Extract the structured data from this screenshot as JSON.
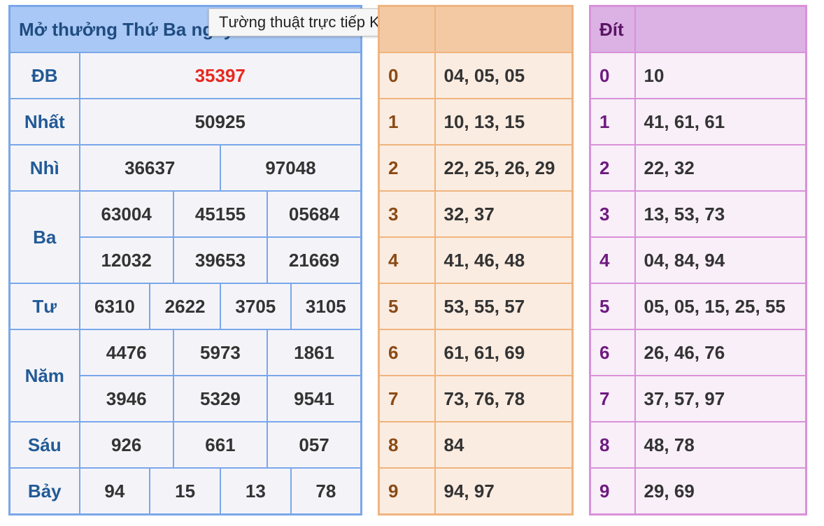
{
  "tooltip": "Tường thuật trực tiếp KQXS",
  "results": {
    "title": "Mở thưởng Thứ Ba ngày",
    "rows": [
      {
        "label": "ĐB",
        "values": [
          "35397"
        ]
      },
      {
        "label": "Nhất",
        "values": [
          "50925"
        ]
      },
      {
        "label": "Nhì",
        "values": [
          "36637",
          "97048"
        ]
      },
      {
        "label": "Ba",
        "values": [
          "63004",
          "45155",
          "05684",
          "12032",
          "39653",
          "21669"
        ]
      },
      {
        "label": "Tư",
        "values": [
          "6310",
          "2622",
          "3705",
          "3105"
        ]
      },
      {
        "label": "Năm",
        "values": [
          "4476",
          "5973",
          "1861",
          "3946",
          "5329",
          "9541"
        ]
      },
      {
        "label": "Sáu",
        "values": [
          "926",
          "661",
          "057"
        ]
      },
      {
        "label": "Bảy",
        "values": [
          "94",
          "15",
          "13",
          "78"
        ]
      }
    ]
  },
  "dau": {
    "header": "",
    "rows": [
      {
        "key": "0",
        "values": "04, 05, 05"
      },
      {
        "key": "1",
        "values": "10, 13, 15"
      },
      {
        "key": "2",
        "values": "22, 25, 26, 29"
      },
      {
        "key": "3",
        "values": "32, 37"
      },
      {
        "key": "4",
        "values": "41, 46, 48"
      },
      {
        "key": "5",
        "values": "53, 55, 57"
      },
      {
        "key": "6",
        "values": "61, 61, 69"
      },
      {
        "key": "7",
        "values": "73, 76, 78"
      },
      {
        "key": "8",
        "values": "84"
      },
      {
        "key": "9",
        "values": "94, 97"
      }
    ]
  },
  "dit": {
    "header": "Đít",
    "rows": [
      {
        "key": "0",
        "values": "10"
      },
      {
        "key": "1",
        "values": "41, 61, 61"
      },
      {
        "key": "2",
        "values": "22, 32"
      },
      {
        "key": "3",
        "values": "13, 53, 73"
      },
      {
        "key": "4",
        "values": "04, 84, 94"
      },
      {
        "key": "5",
        "values": "05, 05, 15, 25, 55"
      },
      {
        "key": "6",
        "values": "26, 46, 76"
      },
      {
        "key": "7",
        "values": "37, 57, 97"
      },
      {
        "key": "8",
        "values": "48, 78"
      },
      {
        "key": "9",
        "values": "29, 69"
      }
    ]
  },
  "colors": {
    "special_prize": "#e8281f",
    "main_border": "#7aa7ea",
    "dau_border": "#f0b47e",
    "dit_border": "#d991d9"
  }
}
